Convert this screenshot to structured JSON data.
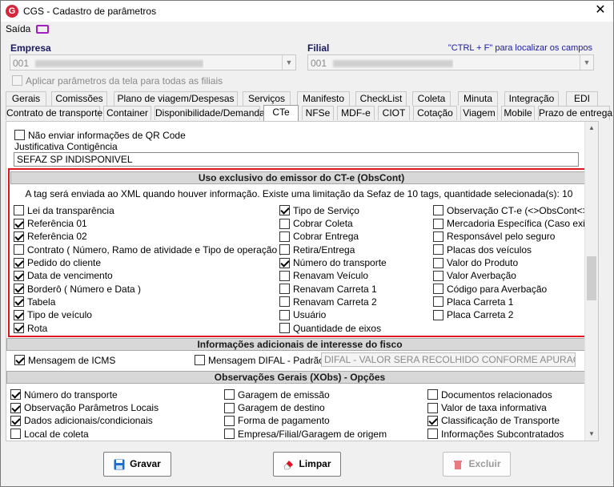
{
  "window": {
    "title": "CGS - Cadastro de parâmetros",
    "close": "✕",
    "app_icon_letter": "G"
  },
  "menu": {
    "saida": "Saída"
  },
  "empresa": {
    "label": "Empresa",
    "value": "001"
  },
  "filial": {
    "label": "Filial",
    "value": "001"
  },
  "hint": "\"CTRL + F\" para localizar os campos",
  "apply_all": {
    "label": "Aplicar parâmetros da tela para todas as filiais",
    "checked": false
  },
  "tabs_row1": [
    "Gerais",
    "Comissões",
    "Plano de viagem/Despesas",
    "Serviços",
    "Manifesto",
    "CheckList",
    "Coleta",
    "Minuta",
    "Integração",
    "EDI"
  ],
  "tabs_row2": [
    "Contrato de transporte",
    "Container",
    "Disponibilidade/Demanda",
    "CTe",
    "NFSe",
    "MDF-e",
    "CIOT",
    "Cotação",
    "Viagem",
    "Mobile",
    "Prazo de entrega"
  ],
  "qr": {
    "label": "Não enviar informações de QR Code",
    "checked": false
  },
  "justificativa": {
    "label": "Justificativa Contigência",
    "value": "SEFAZ SP INDISPONIVEL"
  },
  "obscont": {
    "title": "Uso exclusivo do emissor do CT-e (ObsCont)",
    "info": "A tag será enviada ao XML quando houver informação. Existe uma limitação da Sefaz de 10 tags, quantidade selecionada(s): 10",
    "col1": [
      {
        "label": "Lei da transparência",
        "checked": false
      },
      {
        "label": "Referência 01",
        "checked": true
      },
      {
        "label": "Referência 02",
        "checked": true
      },
      {
        "label": "Contrato ( Número, Ramo de atividade e Tipo de operação )",
        "checked": false
      },
      {
        "label": "Pedido do cliente",
        "checked": true
      },
      {
        "label": "Data de vencimento",
        "checked": true
      },
      {
        "label": "Borderô ( Número e Data )",
        "checked": true
      },
      {
        "label": "Tabela",
        "checked": true
      },
      {
        "label": "Tipo de veículo",
        "checked": true
      },
      {
        "label": "Rota",
        "checked": true
      }
    ],
    "col2": [
      {
        "label": "Tipo de Serviço",
        "checked": true
      },
      {
        "label": "Cobrar Coleta",
        "checked": false
      },
      {
        "label": "Cobrar Entrega",
        "checked": false
      },
      {
        "label": "Retira/Entrega",
        "checked": false
      },
      {
        "label": "Número do transporte",
        "checked": true
      },
      {
        "label": "Renavam Veículo",
        "checked": false
      },
      {
        "label": "Renavam Carreta 1",
        "checked": false
      },
      {
        "label": "Renavam Carreta 2",
        "checked": false
      },
      {
        "label": "Usuário",
        "checked": false
      },
      {
        "label": "Quantidade de eixos",
        "checked": false
      }
    ],
    "col3": [
      {
        "label": "Observação CT-e (<>ObsCont<>)",
        "checked": false
      },
      {
        "label": "Mercadoria Específica (Caso exista)",
        "checked": false
      },
      {
        "label": "Responsável pelo seguro",
        "checked": false
      },
      {
        "label": "Placas dos veículos",
        "checked": false
      },
      {
        "label": "Valor do Produto",
        "checked": false
      },
      {
        "label": "Valor Averbação",
        "checked": false
      },
      {
        "label": "Código para Averbação",
        "checked": false
      },
      {
        "label": "Placa Carreta 1",
        "checked": false
      },
      {
        "label": "Placa Carreta 2",
        "checked": false
      }
    ]
  },
  "fisco": {
    "title": "Informações adicionais de interesse do fisco",
    "icms": {
      "label": "Mensagem de ICMS",
      "checked": true
    },
    "difal": {
      "label": "Mensagem DIFAL - Padrão",
      "checked": false
    },
    "difal_value": "DIFAL - VALOR SERA RECOLHIDO CONFORME APURAÇÃO M"
  },
  "xobs": {
    "title": "Observações Gerais (XObs) - Opções",
    "col1": [
      {
        "label": "Número do transporte",
        "checked": true
      },
      {
        "label": "Observação Parâmetros Locais",
        "checked": true
      },
      {
        "label": "Dados adicionais/condicionais",
        "checked": true
      },
      {
        "label": "Local de coleta",
        "checked": false
      }
    ],
    "col2": [
      {
        "label": "Garagem de emissão",
        "checked": false
      },
      {
        "label": "Garagem de destino",
        "checked": false
      },
      {
        "label": "Forma de pagamento",
        "checked": false
      },
      {
        "label": "Empresa/Filial/Garagem de origem",
        "checked": false
      }
    ],
    "col3": [
      {
        "label": "Documentos relacionados",
        "checked": false
      },
      {
        "label": "Valor de taxa informativa",
        "checked": false
      },
      {
        "label": "Classificação de Transporte",
        "checked": true
      },
      {
        "label": "Informações Subcontratados",
        "checked": false
      }
    ]
  },
  "buttons": {
    "gravar": "Gravar",
    "limpar": "Limpar",
    "excluir": "Excluir"
  },
  "colors": {
    "accent_red": "#e0141e",
    "save_blue": "#1e6fc8"
  }
}
